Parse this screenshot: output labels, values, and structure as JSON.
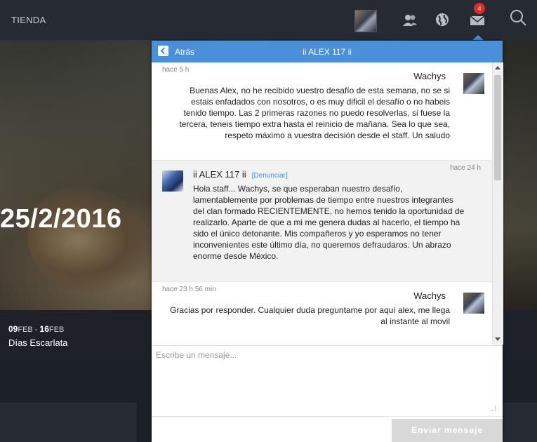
{
  "topbar": {
    "shop_label": "TIENDA",
    "notification_count": "4",
    "icons": [
      "friends-icon",
      "globe-icon",
      "mail-icon",
      "search-icon"
    ]
  },
  "hero": {
    "date": "25/2/2016",
    "event_start_day": "09",
    "event_start_month": "FEB",
    "event_separator": " - ",
    "event_end_day": "16",
    "event_end_month": "FEB",
    "event_name": "Días Escarlata"
  },
  "chat": {
    "back_label": "Atrás",
    "title": "ii ALEX 117 ii",
    "messages": [
      {
        "time": "hace 5 h",
        "author": "Wachys",
        "body": "Buenas Alex, no he recibido vuestro desafío de esta semana, no se si estais enfadados con nosotros, o es muy dificil el desafío o no habeis tenido tiempo. Las 2 primeras razones no puedo resolverlas, si fuese la tercera, teneis tiempo extra hasta el reinicio de mañana. Sea lo que sea, respeto máximo a vuestra decisión desde el staff. Un saludo"
      },
      {
        "time": "hace 24 h",
        "author": "ii ALEX 117 ii",
        "report_label": "[Denunciar]",
        "body": "Hola staff... Wachys, se que esperaban nuestro desafío, lamentablemente por problemas de tiempo entre nuestros integrantes del clan formado RECIENTEMENTE, no hemos tenido la oportunidad de realizarlo. Aparte de que a mi me genera dudas al hacerlo, el tiempo ha sido el único detonante. Mis compañeros y yo esperamos no tener inconvenientes este último día, no queremos defraudaros. Un abrazo enorme desde México."
      },
      {
        "time": "hace 23 h 56 min",
        "author": "Wachys",
        "body": "Gracias por responder. Cualquier duda preguntame por aquí alex, me llega al instante al movil"
      }
    ],
    "composer_placeholder": "Escribe un mensaje...",
    "send_label": "Enviar mensaje"
  },
  "colors": {
    "accent": "#4a90d9",
    "badge": "#e02a2a",
    "topbar": "#262b33"
  }
}
